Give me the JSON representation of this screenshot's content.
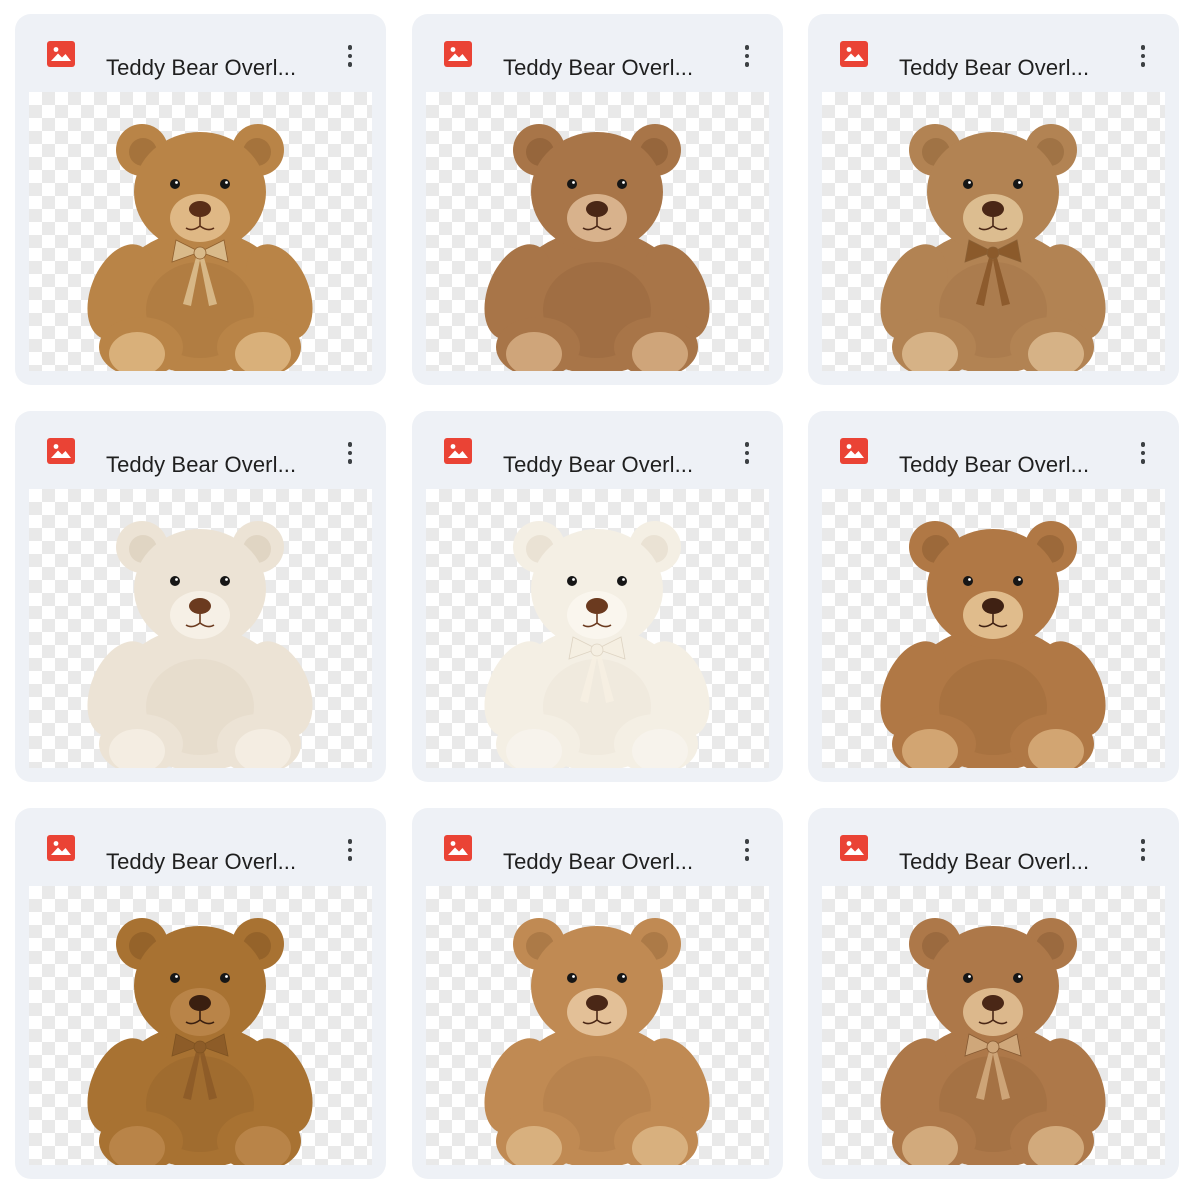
{
  "files": [
    {
      "title": "Teddy Bear Overl...",
      "icon": "image-file-icon",
      "colors": {
        "fur": "#b98447",
        "dark": "#8f5f2e",
        "muzzle": "#dfb885",
        "nose": "#5a2e17",
        "paw": "#d9b07a",
        "ribbon": "#d9ba8a"
      },
      "ribbon": true
    },
    {
      "title": "Teddy Bear Overl...",
      "icon": "image-file-icon",
      "colors": {
        "fur": "#a87548",
        "dark": "#80542f",
        "muzzle": "#d8b28c",
        "nose": "#4a2716",
        "paw": "#cfa57a",
        "ribbon": ""
      },
      "ribbon": false
    },
    {
      "title": "Teddy Bear Overl...",
      "icon": "image-file-icon",
      "colors": {
        "fur": "#b28353",
        "dark": "#8a6035",
        "muzzle": "#dcbd90",
        "nose": "#4a2716",
        "paw": "#d6b286",
        "ribbon": "#8b5a2b"
      },
      "ribbon": true
    },
    {
      "title": "Teddy Bear Overl...",
      "icon": "image-file-icon",
      "colors": {
        "fur": "#ece3d5",
        "dark": "#d3c4ad",
        "muzzle": "#f6f0e6",
        "nose": "#6b3a1f",
        "paw": "#f4ede2",
        "ribbon": ""
      },
      "ribbon": false
    },
    {
      "title": "Teddy Bear Overl...",
      "icon": "image-file-icon",
      "colors": {
        "fur": "#f4efe4",
        "dark": "#ddd3c2",
        "muzzle": "#faf6ee",
        "nose": "#6b3a1f",
        "paw": "#f7f3ec",
        "ribbon": "#f5efe2"
      },
      "ribbon": true
    },
    {
      "title": "Teddy Bear Overl...",
      "icon": "image-file-icon",
      "colors": {
        "fur": "#b07845",
        "dark": "#86562c",
        "muzzle": "#e0bc8c",
        "nose": "#3f2113",
        "paw": "#d2a572",
        "ribbon": ""
      },
      "ribbon": false
    },
    {
      "title": "Teddy Bear Overl...",
      "icon": "image-file-icon",
      "colors": {
        "fur": "#a87232",
        "dark": "#7e5322",
        "muzzle": "#b98448",
        "nose": "#3a1f10",
        "paw": "#b98448",
        "ribbon": "#8d5c28"
      },
      "ribbon": true
    },
    {
      "title": "Teddy Bear Overl...",
      "icon": "image-file-icon",
      "colors": {
        "fur": "#c08a53",
        "dark": "#94663a",
        "muzzle": "#e3c097",
        "nose": "#4a2716",
        "paw": "#d8b07e",
        "ribbon": ""
      },
      "ribbon": false
    },
    {
      "title": "Teddy Bear Overl...",
      "icon": "image-file-icon",
      "colors": {
        "fur": "#ad7849",
        "dark": "#855932",
        "muzzle": "#dcb88c",
        "nose": "#4a2716",
        "paw": "#d2aa7c",
        "ribbon": "#cfa77a"
      },
      "ribbon": true
    }
  ]
}
